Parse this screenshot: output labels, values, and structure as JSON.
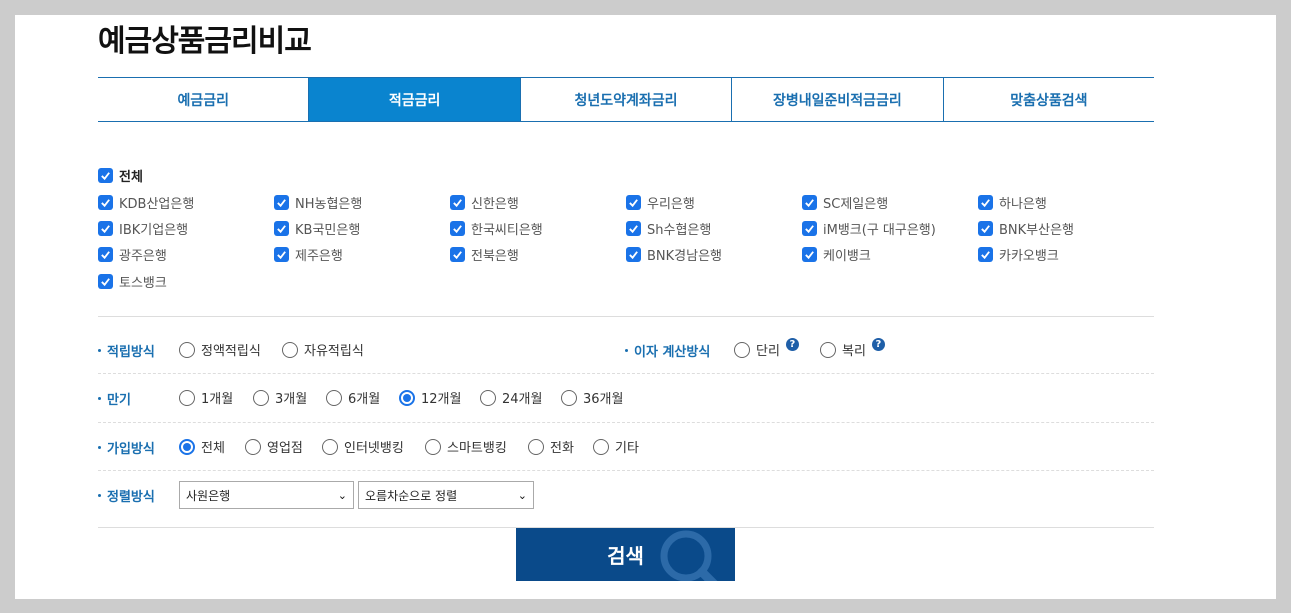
{
  "title": "예금상품금리비교",
  "tabs": [
    {
      "label": "예금금리",
      "active": false
    },
    {
      "label": "적금금리",
      "active": true
    },
    {
      "label": "청년도약계좌금리",
      "active": false
    },
    {
      "label": "장병내일준비적금금리",
      "active": false
    },
    {
      "label": "맞춤상품검색",
      "active": false
    }
  ],
  "banks": {
    "all_label": "전체",
    "items": [
      "KDB산업은행",
      "NH농협은행",
      "신한은행",
      "우리은행",
      "SC제일은행",
      "하나은행",
      "IBK기업은행",
      "KB국민은행",
      "한국씨티은행",
      "Sh수협은행",
      "iM뱅크(구 대구은행)",
      "BNK부산은행",
      "광주은행",
      "제주은행",
      "전북은행",
      "BNK경남은행",
      "케이뱅크",
      "카카오뱅크",
      "토스뱅크"
    ]
  },
  "filters": {
    "saving_method": {
      "label": "적립방식",
      "options": [
        "정액적립식",
        "자유적립식"
      ]
    },
    "interest_method": {
      "label": "이자 계산방식",
      "options": [
        "단리",
        "복리"
      ]
    },
    "term": {
      "label": "만기",
      "options": [
        "1개월",
        "3개월",
        "6개월",
        "12개월",
        "24개월",
        "36개월"
      ],
      "selected": "12개월"
    },
    "join_method": {
      "label": "가입방식",
      "options": [
        "전체",
        "영업점",
        "인터넷뱅킹",
        "스마트뱅킹",
        "전화",
        "기타"
      ],
      "selected": "전체"
    },
    "sort_method": {
      "label": "정렬방식",
      "select1": "사원은행",
      "select2": "오름차순으로 정렬"
    }
  },
  "search_button": "검색",
  "colors": {
    "accent": "#1a6fb0",
    "active_tab": "#0a84cf",
    "button": "#0a4a8a",
    "checkbox": "#1a73e8"
  }
}
